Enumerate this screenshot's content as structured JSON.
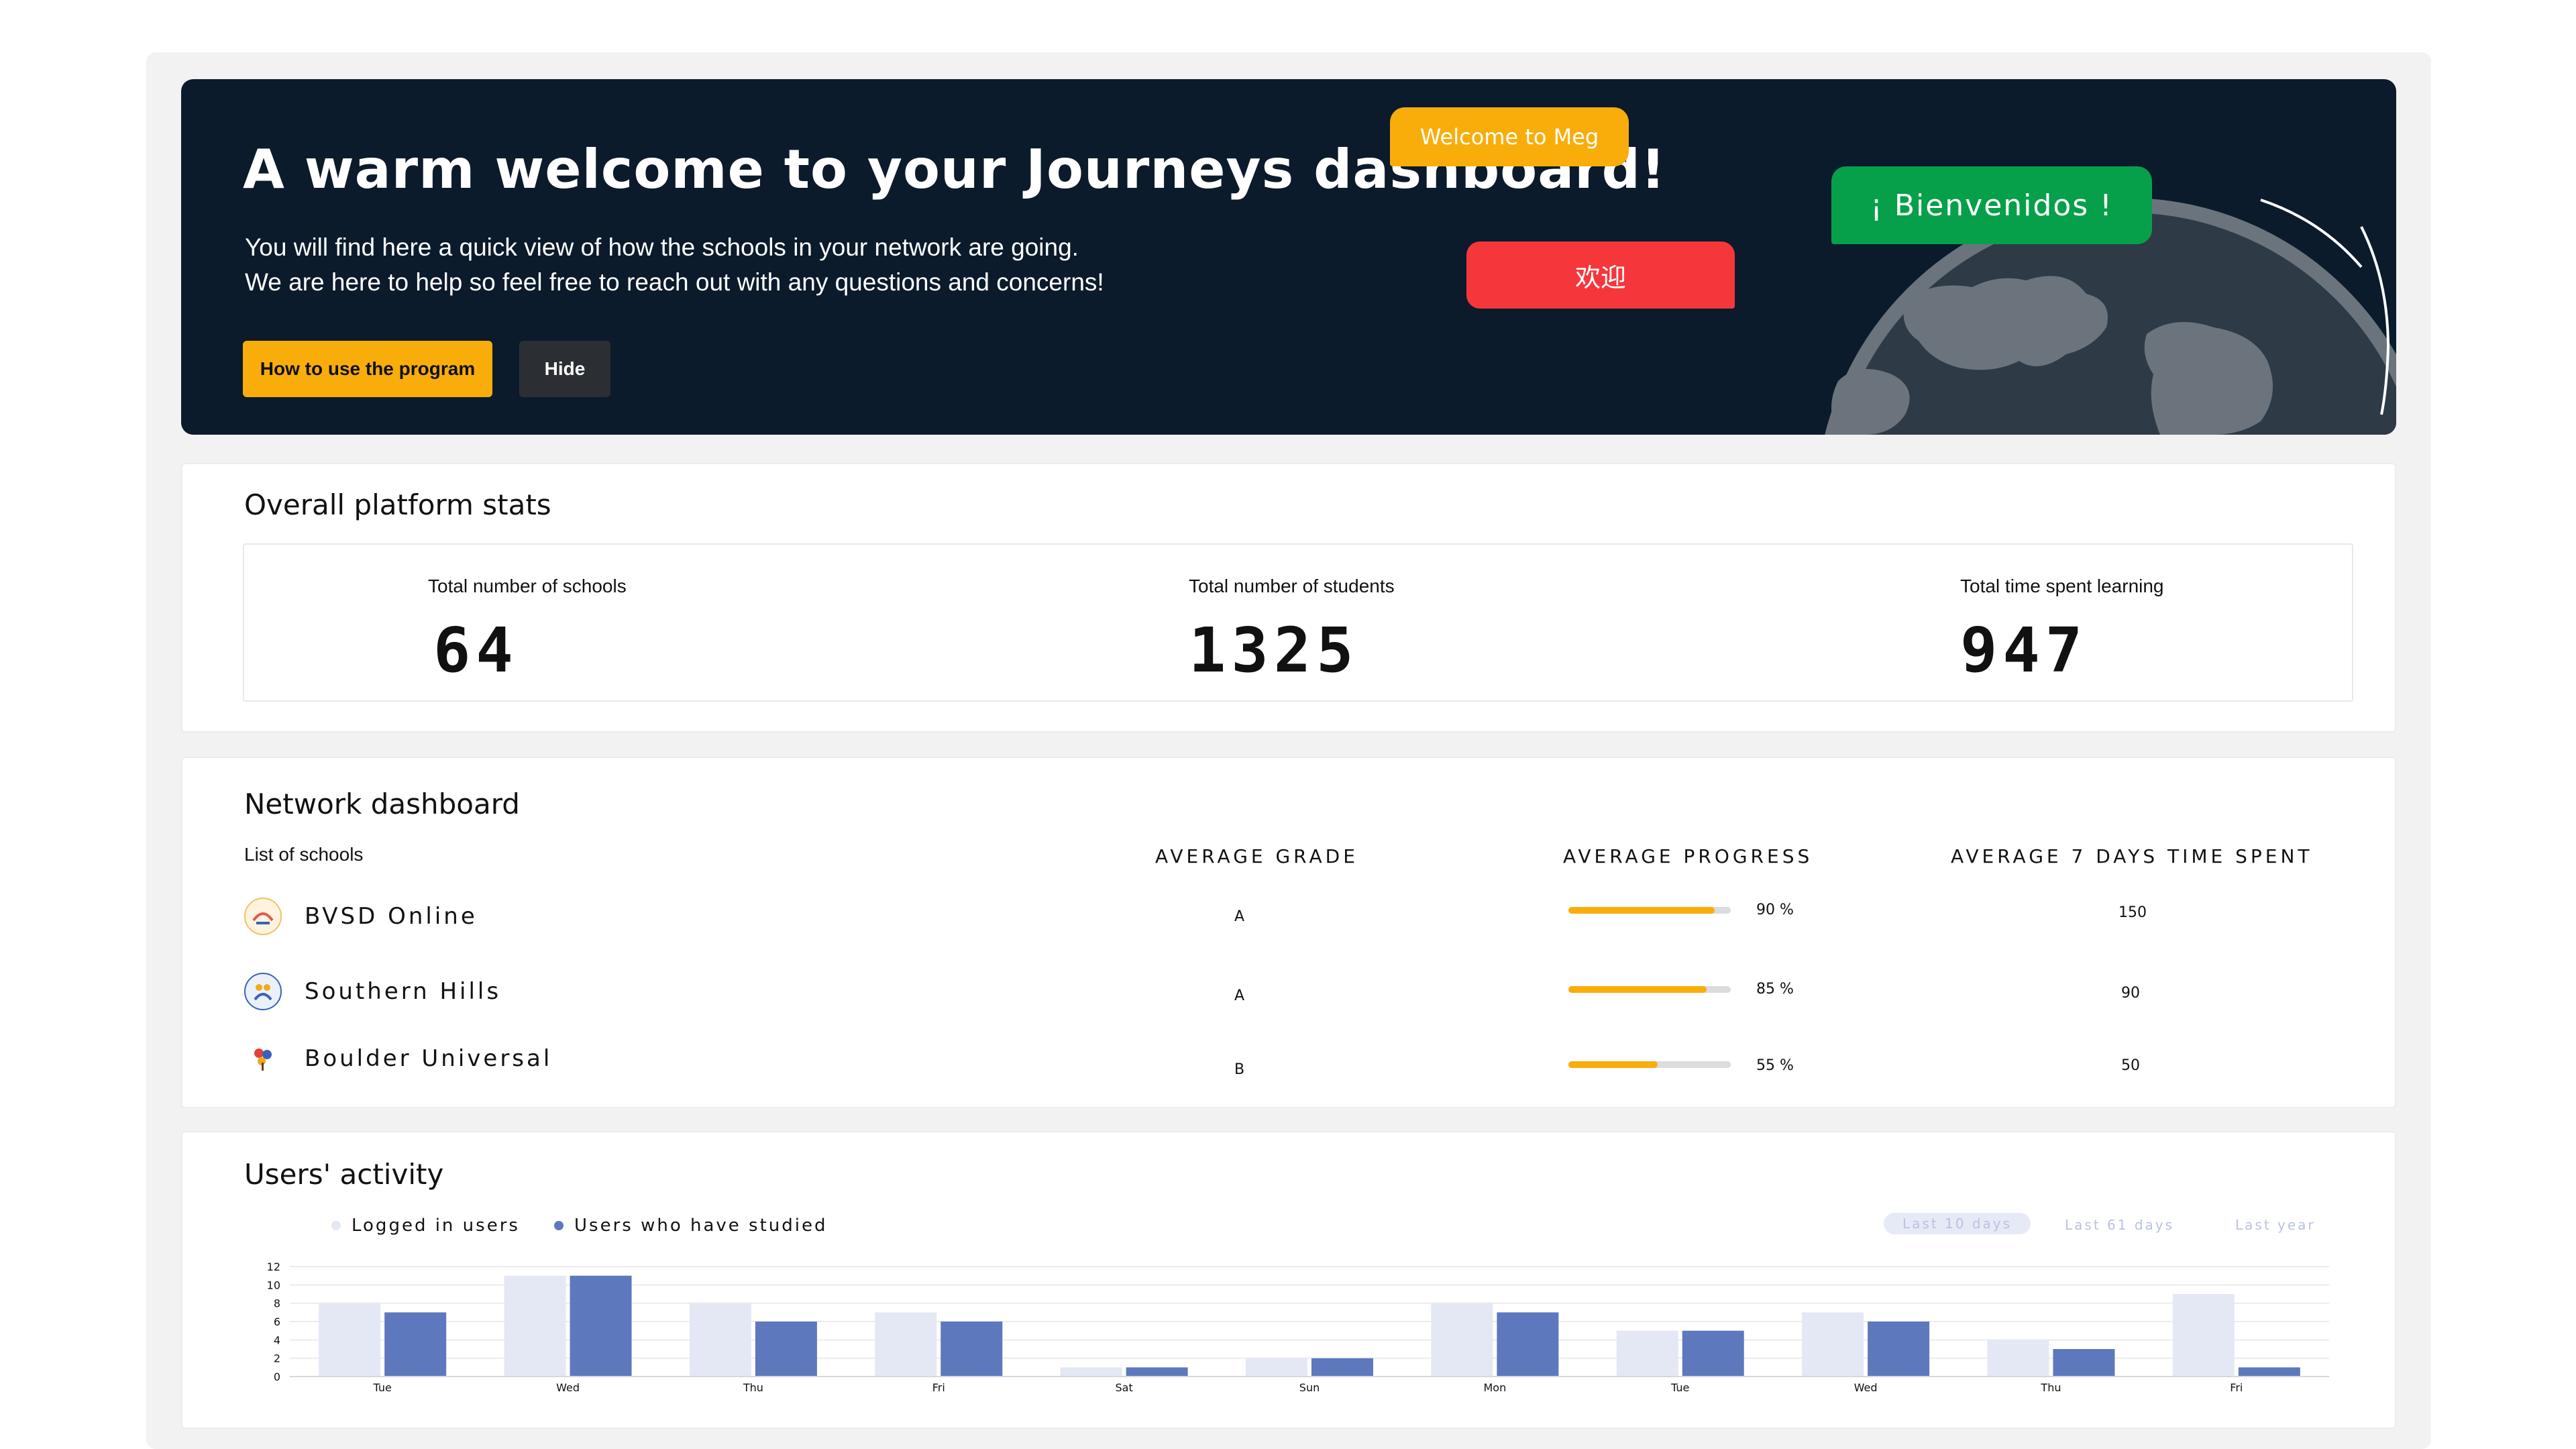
{
  "hero": {
    "title": "A warm welcome to your Journeys dashboard!",
    "line1": "You will find here a quick view of how the schools in your network are going.",
    "line2": "We are here to help so feel free to reach out with any questions and concerns!",
    "primary_button": "How to use the program",
    "secondary_button": "Hide",
    "bubble_en": "Welcome to Meg",
    "bubble_zh": "欢迎",
    "bubble_es": "¡ Bienvenidos !"
  },
  "stats": {
    "title": "Overall platform stats",
    "items": [
      {
        "label": "Total number of schools",
        "value": "64"
      },
      {
        "label": "Total number of students",
        "value": "1325"
      },
      {
        "label": "Total time spent learning",
        "value": "947"
      }
    ]
  },
  "network": {
    "title": "Network dashboard",
    "subtitle": "List of schools",
    "columns": {
      "grade": "AVERAGE GRADE",
      "progress": "AVERAGE PROGRESS",
      "time": "AVERAGE 7 DAYS TIME SPENT"
    },
    "schools": [
      {
        "name": "BVSD Online",
        "grade": "A",
        "progress": 0.9,
        "progress_label": "90 %",
        "time": "150"
      },
      {
        "name": "Southern Hills",
        "grade": "A",
        "progress": 0.85,
        "progress_label": "85 %",
        "time": "90"
      },
      {
        "name": "Boulder Universal",
        "grade": "B",
        "progress": 0.55,
        "progress_label": "55 %",
        "time": "50"
      }
    ]
  },
  "activity": {
    "title": "Users' activity",
    "ranges": [
      "Last 10 days",
      "Last 61 days",
      "Last year"
    ],
    "active_range": "Last 10 days",
    "colors": {
      "logged": "#e3e8f4",
      "studied": "#5e78bd"
    }
  },
  "chart_data": {
    "type": "bar",
    "categories": [
      "Tue",
      "Wed",
      "Thu",
      "Fri",
      "Sat",
      "Sun",
      "Mon",
      "Tue",
      "Wed",
      "Thu",
      "Fri"
    ],
    "series": [
      {
        "name": "Logged in users",
        "values": [
          8,
          11,
          8,
          7,
          1,
          2,
          8,
          5,
          7,
          4,
          9
        ]
      },
      {
        "name": "Users who have studied",
        "values": [
          7,
          11,
          6,
          6,
          1,
          2,
          7,
          5,
          6,
          3,
          1
        ]
      }
    ],
    "yticks": [
      0,
      2,
      4,
      6,
      8,
      10,
      12
    ],
    "ylim": [
      0,
      12
    ],
    "grid": true,
    "legend": "top-left"
  }
}
